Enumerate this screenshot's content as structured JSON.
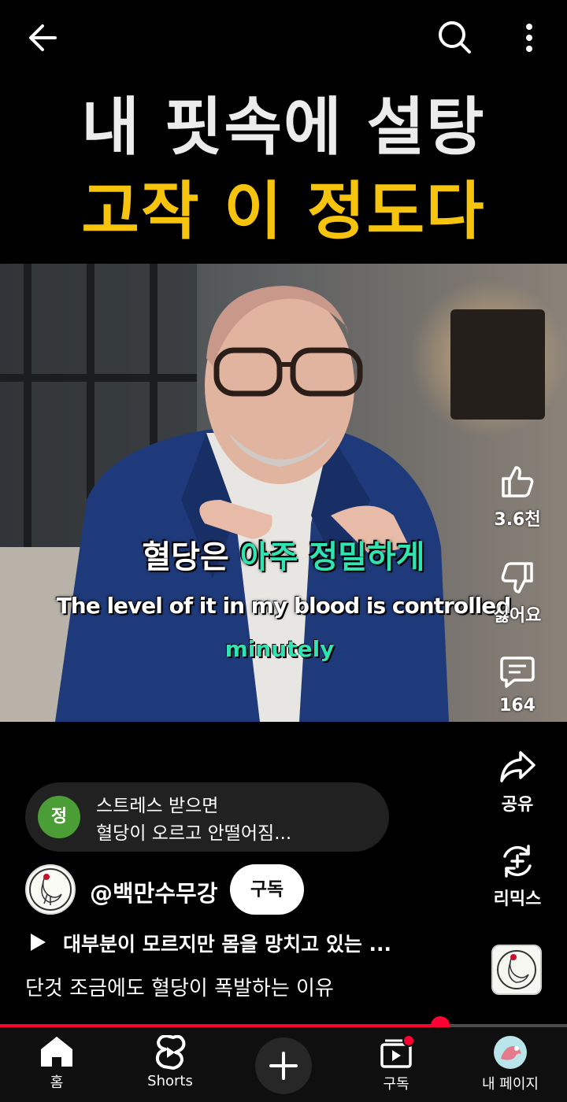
{
  "topbar": {
    "back_icon": "arrow-left-icon",
    "search_icon": "search-icon",
    "more_icon": "more-vertical-icon"
  },
  "headline": {
    "line1": "내 핏속에 설탕",
    "line2": "고작 이 정도다",
    "line1_color": "#ececec",
    "line2_color": "#f6c40c"
  },
  "captions": {
    "korean_white": "혈당은",
    "korean_green": "아주 정밀하게",
    "english_line1": "The level of it in my blood is controlled",
    "english_line2": "minutely",
    "accent_color": "#2fe3b2"
  },
  "actions": {
    "like": {
      "icon": "thumbs-up-icon",
      "label": "3.6천"
    },
    "dislike": {
      "icon": "thumbs-down-icon",
      "label": "싫어요"
    },
    "comments": {
      "icon": "comment-icon",
      "label": "164"
    },
    "share": {
      "icon": "share-icon",
      "label": "공유"
    },
    "remix": {
      "icon": "remix-icon",
      "label": "리믹스"
    }
  },
  "comment_preview": {
    "avatar_letter": "정",
    "avatar_color": "#4a9e35",
    "line1": "스트레스 받으면",
    "line2": "혈당이 오르고 안떨어짐..."
  },
  "channel": {
    "name": "@백만수무강",
    "subscribe_label": "구독"
  },
  "playlist": {
    "icon": "play-icon",
    "title": "대부분이 모르지만 몸을 망치고 있는 ..."
  },
  "description": "단것 조금에도 혈당이 폭발하는 이유",
  "progress": {
    "fraction": 0.776,
    "color": "#ff0033"
  },
  "nav": {
    "home": {
      "icon": "home-icon",
      "label": "홈"
    },
    "shorts": {
      "icon": "shorts-icon",
      "label": "Shorts"
    },
    "create": {
      "icon": "plus-icon"
    },
    "subscriptions": {
      "icon": "subscriptions-icon",
      "label": "구독"
    },
    "you": {
      "icon": "profile-avatar-icon",
      "label": "내 페이지"
    }
  }
}
